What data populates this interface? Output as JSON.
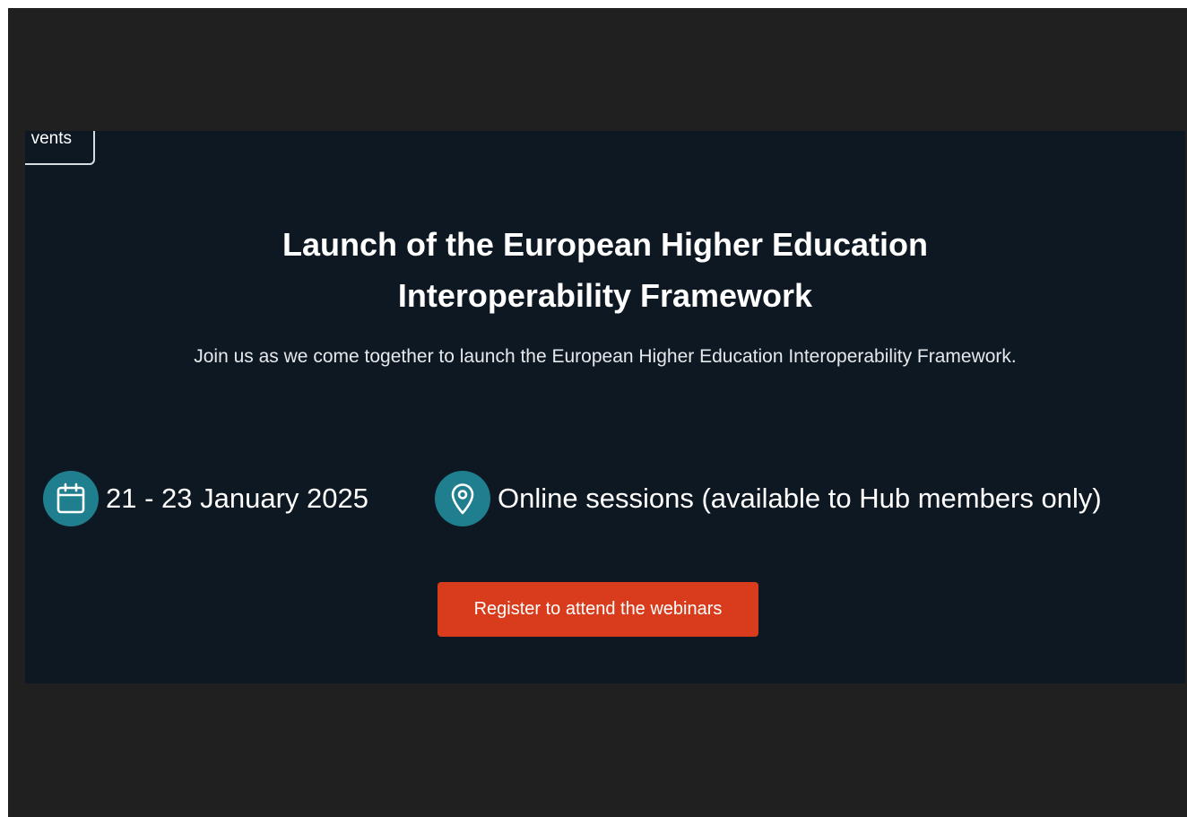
{
  "nav": {
    "back_label": "vents"
  },
  "event": {
    "title_line1": "Launch of the European Higher Education",
    "title_line2": "Interoperability Framework",
    "description": "Join us as we come together to launch the European Higher Education Interoperability Framework.",
    "date": "21 - 23 January 2025",
    "location": "Online sessions (available to Hub members only)",
    "register_label": "Register to attend the webinars"
  },
  "icons": {
    "date": "calendar-icon",
    "location": "location-pin-icon"
  },
  "colors": {
    "banner_background": "#0e1822",
    "icon_circle": "#1f7f8e",
    "button": "#d83c1c",
    "text": "#ffffff"
  }
}
